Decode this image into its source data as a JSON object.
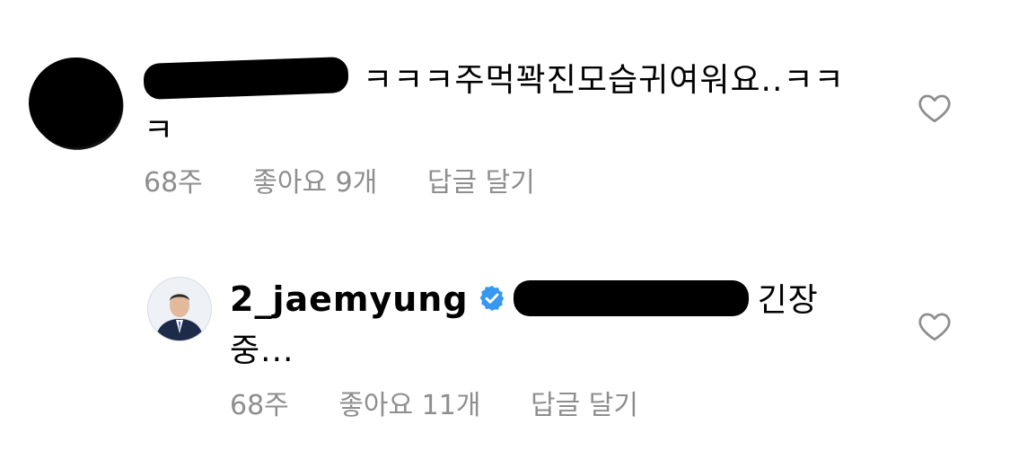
{
  "comments": [
    {
      "text": "ㅋㅋㅋ주먹꽉진모습귀여워요..ㅋㅋㅋ",
      "time": "68주",
      "likes": "좋아요 9개",
      "reply_label": "답글 달기"
    },
    {
      "username": "2_jaemyung",
      "text": "긴장중...",
      "time": "68주",
      "likes": "좋아요 11개",
      "reply_label": "답글 달기"
    }
  ],
  "icons": {
    "like": "heart-outline-icon",
    "verified": "verified-badge-icon"
  },
  "colors": {
    "meta_text": "#8e8e8e",
    "verified_blue": "#3897f0",
    "heart_stroke": "#8e8e8e"
  }
}
